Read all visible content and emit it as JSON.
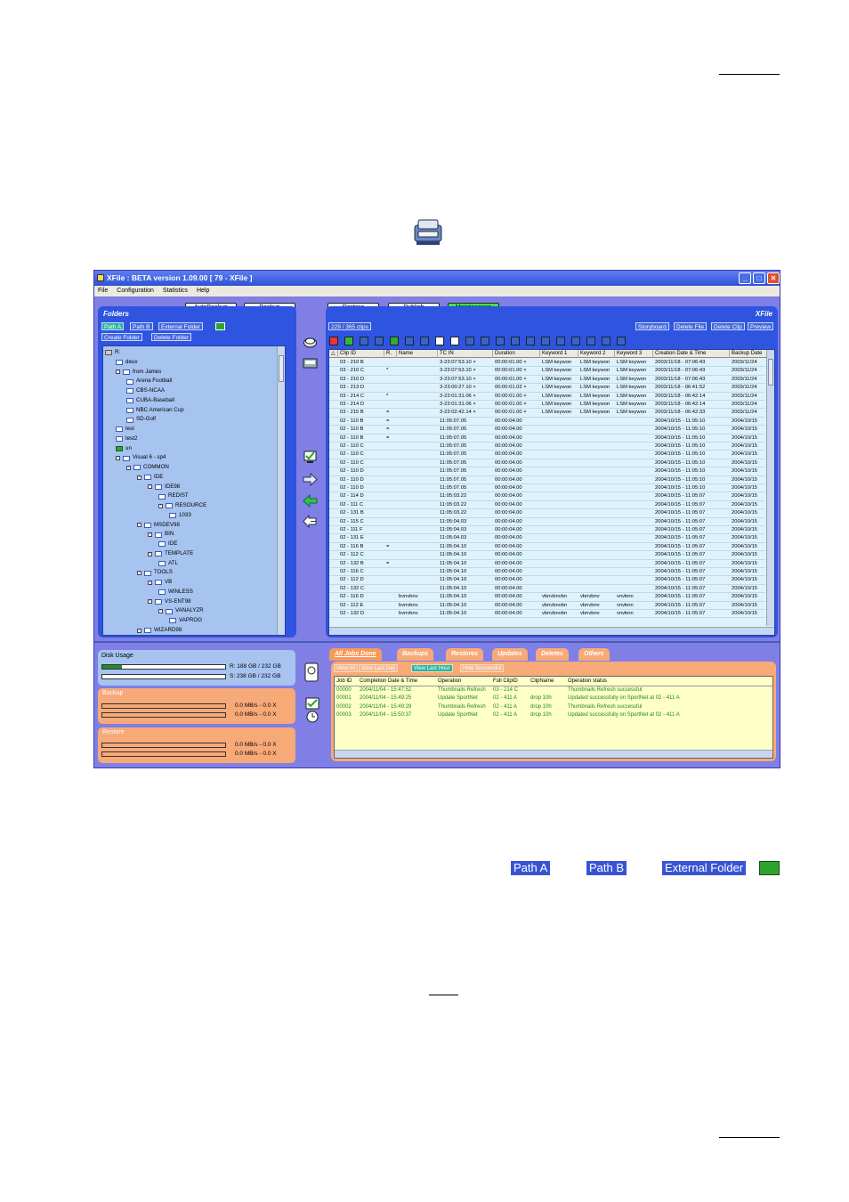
{
  "window": {
    "title": "XFile : BETA version 1.09.00 [ 79 - XFile ]",
    "menu": [
      "File",
      "Configuration",
      "Statistics",
      "Help"
    ]
  },
  "toolbar": {
    "autobackup": "AutoBackup",
    "backup": "Backup",
    "restore": "Restore",
    "publish": "Publish",
    "maintenance": "Maintenance"
  },
  "folders": {
    "title": "Folders",
    "path_a": "Path A",
    "path_b": "Path B",
    "external": "External Folder",
    "create": "Create Folder",
    "delete": "Delete Folder",
    "tree": [
      {
        "label": "R:",
        "level": 0,
        "kind": "drive"
      },
      {
        "label": "deux",
        "level": 1
      },
      {
        "label": "from James",
        "level": 1,
        "exp": "-"
      },
      {
        "label": "Arena Football",
        "level": 2
      },
      {
        "label": "CBS-NCAA",
        "level": 2
      },
      {
        "label": "CUBA-Baseball",
        "level": 2
      },
      {
        "label": "NBC American Cup",
        "level": 2
      },
      {
        "label": "SD-Golf",
        "level": 2
      },
      {
        "label": "test",
        "level": 1
      },
      {
        "label": "test2",
        "level": 1
      },
      {
        "label": "un",
        "level": 1,
        "kind": "green"
      },
      {
        "label": "Visual 6 - sp4",
        "level": 1,
        "exp": "-"
      },
      {
        "label": "COMMON",
        "level": 2,
        "exp": "-"
      },
      {
        "label": "IDE",
        "level": 3,
        "exp": "-"
      },
      {
        "label": "IDE98",
        "level": 4,
        "exp": "-"
      },
      {
        "label": "REDIST",
        "level": 5
      },
      {
        "label": "RESOURCE",
        "level": 5,
        "exp": "-"
      },
      {
        "label": "1033",
        "level": 6
      },
      {
        "label": "MSDEV98",
        "level": 3,
        "exp": "-"
      },
      {
        "label": "BIN",
        "level": 4,
        "exp": "-"
      },
      {
        "label": "IDE",
        "level": 5
      },
      {
        "label": "TEMPLATE",
        "level": 4,
        "exp": "-"
      },
      {
        "label": "ATL",
        "level": 5
      },
      {
        "label": "TOOLS",
        "level": 3,
        "exp": "-"
      },
      {
        "label": "VB",
        "level": 4,
        "exp": "-"
      },
      {
        "label": "WINLESS",
        "level": 5
      },
      {
        "label": "VS-ENT98",
        "level": 4,
        "exp": "-"
      },
      {
        "label": "VANALYZR",
        "level": 5,
        "exp": "-"
      },
      {
        "label": "VAPROG",
        "level": 6
      },
      {
        "label": "WIZARD98",
        "level": 3,
        "exp": "-"
      }
    ]
  },
  "xfile": {
    "title": "XFile",
    "clip_count": "229 / 365 clips",
    "actions": [
      "Storyboard",
      "Delete File",
      "Delete Clip",
      "Preview"
    ],
    "columns": [
      "Clip ID",
      "R.",
      "Name",
      "TC IN",
      "Duration",
      "Keyword 1",
      "Keyword 2",
      "Keyword 3",
      "Creation Date & Time",
      "Backup Date"
    ],
    "rows": [
      [
        "03 - 210 B",
        "",
        "",
        "3-23:07:53.10 ×",
        "00:00:01.00 ×",
        "LSM keywon",
        "LSM keywon",
        "LSM keywon",
        "2003/11/18 - 07:06:43",
        "2003/11/24"
      ],
      [
        "03 - 210 C",
        "*",
        "",
        "3-23:07:53.10 ×",
        "00:00:01.00 ×",
        "LSM keywon",
        "LSM keywon",
        "LSM keywon",
        "2003/11/18 - 07:06:43",
        "2003/11/24"
      ],
      [
        "03 - 210 D",
        "",
        "",
        "3-23:07:53.10 ×",
        "00:00:01.00 ×",
        "LSM keywon",
        "LSM keywon",
        "LSM keywon",
        "2003/11/18 - 07:06:43",
        "2003/11/24"
      ],
      [
        "03 - 213 D",
        "",
        "",
        "3-23:00:27.10 ×",
        "00:00:01.02 ×",
        "LSM keywon",
        "LSM keywon",
        "LSM keywon",
        "2003/11/18 - 06:41:52",
        "2003/11/24"
      ],
      [
        "03 - 214 C",
        "*",
        "",
        "3-23:01:31.06 ×",
        "00:00:01.00 ×",
        "LSM keywon",
        "LSM keywon",
        "LSM keywon",
        "2003/11/18 - 06:42:14",
        "2003/11/24"
      ],
      [
        "03 - 214 D",
        "",
        "",
        "3-23:01:31.06 ×",
        "00:00:01.00 ×",
        "LSM keywon",
        "LSM keywon",
        "LSM keywon",
        "2003/11/18 - 06:42:14",
        "2003/11/24"
      ],
      [
        "03 - 215 B",
        "=",
        "",
        "3-23:02:42.14 ×",
        "00:00:01.00 ×",
        "LSM keywon",
        "LSM keywon",
        "LSM keywon",
        "2003/11/18 - 06:42:33",
        "2003/11/24"
      ],
      [
        "02 - 110 B",
        "=",
        "",
        "11:05:07.05",
        "00:00:04.00",
        "",
        "",
        "",
        "2004/10/15 - 11:05:10",
        "2004/10/15"
      ],
      [
        "02 - 110 B",
        "=",
        "",
        "11:05:07.05",
        "00:00:04.00",
        "",
        "",
        "",
        "2004/10/15 - 11:05:10",
        "2004/10/15"
      ],
      [
        "02 - 110 B",
        "=",
        "",
        "11:05:07.05",
        "00:00:04.00",
        "",
        "",
        "",
        "2004/10/15 - 11:05:10",
        "2004/10/15"
      ],
      [
        "02 - 110 C",
        "",
        "",
        "11:05:07.05",
        "00:00:04.00",
        "",
        "",
        "",
        "2004/10/15 - 11:05:10",
        "2004/10/15"
      ],
      [
        "02 - 110 C",
        "",
        "",
        "11:05:07.05",
        "00:00:04.00",
        "",
        "",
        "",
        "2004/10/15 - 11:05:10",
        "2004/10/15"
      ],
      [
        "02 - 110 C",
        "",
        "",
        "11:05:07.05",
        "00:00:04.00",
        "",
        "",
        "",
        "2004/10/15 - 11:05:10",
        "2004/10/15"
      ],
      [
        "02 - 110 D",
        "",
        "",
        "11:05:07.05",
        "00:00:04.00",
        "",
        "",
        "",
        "2004/10/15 - 11:05:10",
        "2004/10/15"
      ],
      [
        "02 - 110 D",
        "",
        "",
        "11:05:07.05",
        "00:00:04.00",
        "",
        "",
        "",
        "2004/10/15 - 11:05:10",
        "2004/10/15"
      ],
      [
        "02 - 110 D",
        "",
        "",
        "11:05:07.05",
        "00:00:04.00",
        "",
        "",
        "",
        "2004/10/15 - 11:05:10",
        "2004/10/15"
      ],
      [
        "02 - 114 D",
        "",
        "",
        "11:05:03.22",
        "00:00:04.00",
        "",
        "",
        "",
        "2004/10/15 - 11:05:07",
        "2004/10/15"
      ],
      [
        "02 - 111 C",
        "",
        "",
        "11:05:03.22",
        "00:00:04.00",
        "",
        "",
        "",
        "2004/10/15 - 11:05:07",
        "2004/10/15"
      ],
      [
        "02 - 131 B",
        "",
        "",
        "11:05:03.22",
        "00:00:04.00",
        "",
        "",
        "",
        "2004/10/15 - 11:05:07",
        "2004/10/15"
      ],
      [
        "02 - 115 C",
        "",
        "",
        "11:05:04.03",
        "00:00:04.00",
        "",
        "",
        "",
        "2004/10/15 - 11:05:07",
        "2004/10/15"
      ],
      [
        "02 - 111 F",
        "",
        "",
        "11:05:04.03",
        "00:00:04.00",
        "",
        "",
        "",
        "2004/10/15 - 11:05:07",
        "2004/10/15"
      ],
      [
        "02 - 131 E",
        "",
        "",
        "11:05:04.03",
        "00:00:04.00",
        "",
        "",
        "",
        "2004/10/15 - 11:05:07",
        "2004/10/15"
      ],
      [
        "02 - 116 B",
        "=",
        "",
        "11:05:04.10",
        "00:00:04.00",
        "",
        "",
        "",
        "2004/10/15 - 11:05:07",
        "2004/10/15"
      ],
      [
        "02 - 112 C",
        "",
        "",
        "11:05:04.10",
        "00:00:04.00",
        "",
        "",
        "",
        "2004/10/15 - 11:05:07",
        "2004/10/15"
      ],
      [
        "02 - 132 B",
        "=",
        "",
        "11:05:04.10",
        "00:00:04.00",
        "",
        "",
        "",
        "2004/10/15 - 11:05:07",
        "2004/10/15"
      ],
      [
        "02 - 116 C",
        "",
        "",
        "11:05:04.10",
        "00:00:04.00",
        "",
        "",
        "",
        "2004/10/15 - 11:05:07",
        "2004/10/15"
      ],
      [
        "02 - 112 D",
        "",
        "",
        "11:05:04.10",
        "00:00:04.00",
        "",
        "",
        "",
        "2004/10/15 - 11:05:07",
        "2004/10/15"
      ],
      [
        "02 - 132 C",
        "",
        "",
        "11:05:04.10",
        "00:00:04.00",
        "",
        "",
        "",
        "2004/10/15 - 11:05:07",
        "2004/10/15"
      ],
      [
        "02 - 116 D",
        "",
        "bvnvbnv",
        "11:05:04.10",
        "00:00:04.00",
        "vbnvbnvbn",
        "vbnvbnv",
        "vnvbnn",
        "2004/10/15 - 11:05:07",
        "2004/10/15"
      ],
      [
        "02 - 112 E",
        "",
        "bvnvbnv",
        "11:05:04.10",
        "00:00:04.00",
        "vbnvbnvbn",
        "vbnvbnv",
        "vnvbnn",
        "2004/10/15 - 11:05:07",
        "2004/10/15"
      ],
      [
        "02 - 132 D",
        "",
        "bvnvbnv",
        "11:05:04.10",
        "00:00:04.00",
        "vbnvbnvbn",
        "vbnvbnv",
        "vnvbnn",
        "2004/10/15 - 11:05:07",
        "2004/10/15"
      ]
    ]
  },
  "stats": {
    "disk_title": "Disk Usage",
    "disk_r": "R: 188 GB / 232 GB",
    "disk_s": "S: 238 GB / 232 GB",
    "disk_r_fill": 0.16,
    "disk_s_fill": 0.0,
    "backup_title": "Backup",
    "backup_l1": "0.0 MB/s - 0.0 X",
    "backup_l2": "0.0 MB/s - 0.0 X",
    "restore_title": "Restore",
    "restore_l1": "0.0 MB/s - 0.0 X",
    "restore_l2": "0.0 MB/s - 0.0 X"
  },
  "jobs": {
    "tabs": [
      "All Jobs Done",
      "Backups",
      "Restores",
      "Updates",
      "Deletes",
      "Others"
    ],
    "filters": [
      "View All",
      "View Last Day",
      "View Last Hour",
      "Hide Successful"
    ],
    "columns": [
      "Job ID",
      "Completion Date & Time",
      "Operation",
      "Full ClipID",
      "ClipName",
      "Operation status"
    ],
    "rows": [
      [
        "00000",
        "2004/11/04 - 15:47:52",
        "Thumbnails Refresh",
        "03 - 214 C",
        "",
        "Thumbnails Refresh successful"
      ],
      [
        "00001",
        "2004/11/04 - 15:49:25",
        "Update SportNet",
        "02 - 411 A",
        "drop 10h",
        "Updated successfully on SportNet at 02 - 411 A"
      ],
      [
        "00002",
        "2004/11/04 - 15:49:29",
        "Thumbnails Refresh",
        "02 - 411 A",
        "drop 10h",
        "Thumbnails Refresh successful"
      ],
      [
        "00003",
        "2004/11/04 - 15:50:37",
        "Update SportNet",
        "02 - 411 A",
        "drop 10h",
        "Updated successfully on SportNet at 02 - 411 A"
      ]
    ]
  },
  "legend": {
    "path_a": "Path A",
    "path_b": "Path B",
    "external": "External Folder"
  },
  "colors": {
    "panel_blue": "#2e54e0",
    "orange": "#f7a978",
    "maintenance_green": "#47e14f",
    "job_text_green": "#1a8a1a"
  }
}
